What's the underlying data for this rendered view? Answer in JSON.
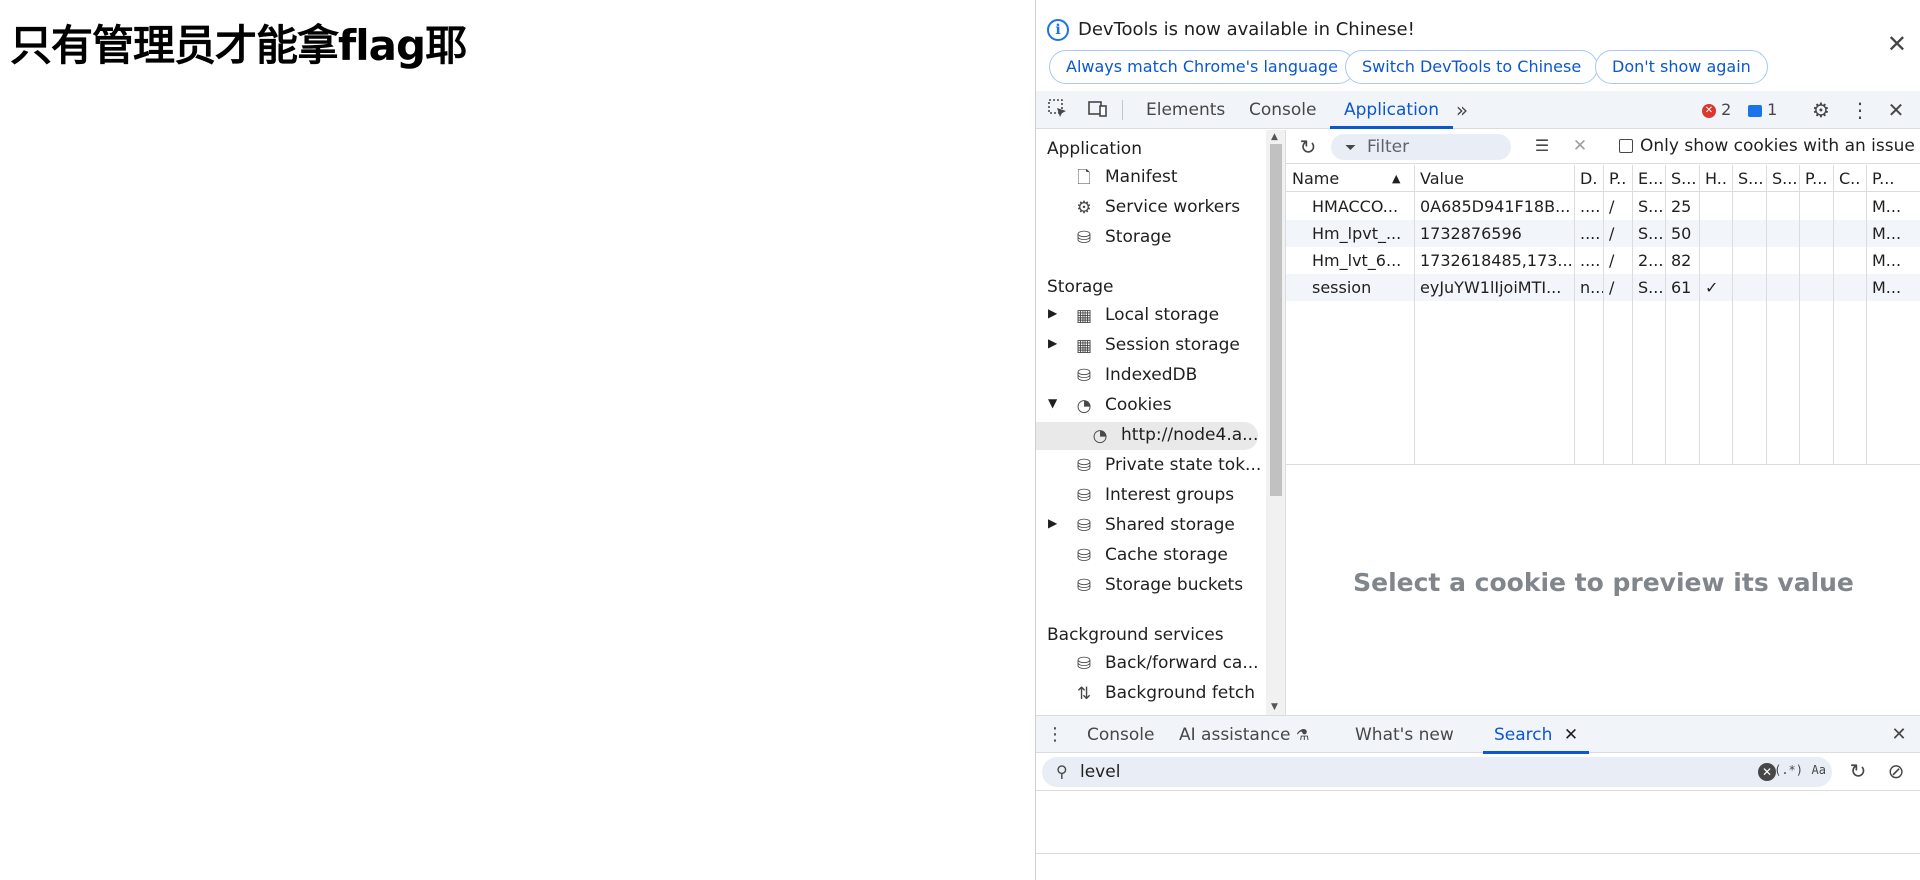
{
  "page": {
    "heading": "只有管理员才能拿flag耶"
  },
  "infobar": {
    "message": "DevTools is now available in Chinese!",
    "buttons": [
      "Always match Chrome's language",
      "Switch DevTools to Chinese",
      "Don't show again"
    ]
  },
  "toolbar": {
    "tabs": [
      "Elements",
      "Console",
      "Application"
    ],
    "active_tab": "Application",
    "more": "»",
    "error_count": "2",
    "message_count": "1"
  },
  "sidebar": {
    "sections": [
      {
        "title": "Application",
        "items": [
          "Manifest",
          "Service workers",
          "Storage"
        ]
      },
      {
        "title": "Storage",
        "items": [
          "Local storage",
          "Session storage",
          "IndexedDB",
          "Cookies",
          "http://node4.a...",
          "Private state tok...",
          "Interest groups",
          "Shared storage",
          "Cache storage",
          "Storage buckets"
        ]
      },
      {
        "title": "Background services",
        "items": [
          "Back/forward ca...",
          "Background fetch"
        ]
      }
    ],
    "selected_item": "http://node4.a..."
  },
  "cookies": {
    "filter_placeholder": "Filter",
    "only_issues_label": "Only show cookies with an issue",
    "columns": [
      "Name",
      "Value",
      "D.",
      "P..",
      "E...",
      "S...",
      "H..",
      "S...",
      "S...",
      "P...",
      "C..",
      "P..."
    ],
    "rows": [
      [
        "HMACCO...",
        "0A685D941F18B...",
        "....",
        "/",
        "S...",
        "25",
        "",
        "",
        "",
        "",
        "",
        "M..."
      ],
      [
        "Hm_lpvt_...",
        "1732876596",
        "....",
        "/",
        "S...",
        "50",
        "",
        "",
        "",
        "",
        "",
        "M..."
      ],
      [
        "Hm_lvt_6...",
        "1732618485,173...",
        "....",
        "/",
        "2...",
        "82",
        "",
        "",
        "",
        "",
        "",
        "M..."
      ],
      [
        "session",
        "eyJuYW1lIjoiMTI...",
        "n...",
        "/",
        "S...",
        "61",
        "✓",
        "",
        "",
        "",
        "",
        "M..."
      ]
    ],
    "preview_text": "Select a cookie to preview its value"
  },
  "drawer": {
    "tabs": [
      "Console",
      "AI assistance",
      "What's new",
      "Search"
    ],
    "active_tab": "Search",
    "search_query": "level",
    "regex_label": "(.*)",
    "case_label": "Aa"
  },
  "colors": {
    "accent": "#0b57d0",
    "toolbar_bg": "#f1f4f9",
    "error": "#dc362e"
  }
}
